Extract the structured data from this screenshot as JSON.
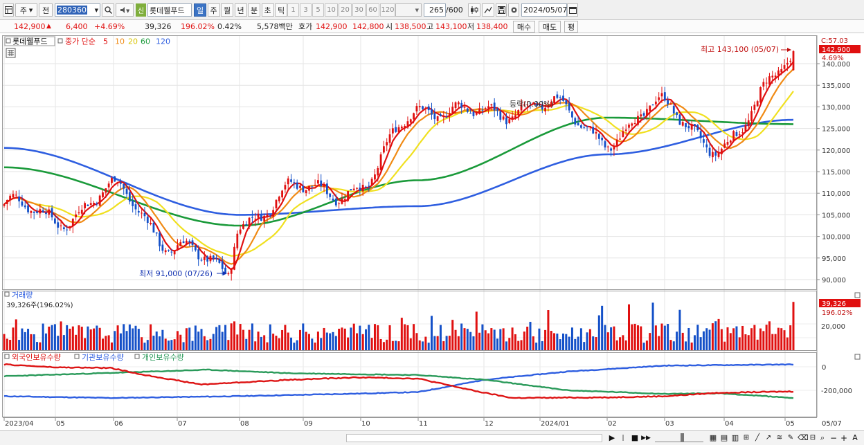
{
  "toolbar": {
    "market": "주",
    "prev_label": "전",
    "code": "280360",
    "stock_name": "롯데웰푸드",
    "periods": [
      "일",
      "주",
      "월",
      "년",
      "분",
      "초",
      "틱"
    ],
    "active_period": "일",
    "numbers": [
      "1",
      "3",
      "5",
      "10",
      "20",
      "30",
      "60",
      "120"
    ],
    "count": "265",
    "total": "/600",
    "date": "2024/05/07",
    "new_badge": "신"
  },
  "quote": {
    "price": "142,900",
    "change": "6,400",
    "change_pct": "+4.69%",
    "volume": "39,326",
    "vol_ratio": "196.02%",
    "turnover": "0.42%",
    "amount": "5,578백만",
    "ask_label": "호가",
    "ask": "142,900",
    "bid": "142,800",
    "open_label": "시",
    "open": "138,500",
    "high_label": "고",
    "high": "143,100",
    "low_label": "저",
    "low": "138,400",
    "buy_label": "매수",
    "sell_label": "매도",
    "eval_label": "평"
  },
  "price_panel": {
    "legend_name": "롯데웰푸드",
    "legend_ma_label": "종가 단순",
    "legend_periods": [
      "5",
      "10",
      "20",
      "60",
      "120"
    ],
    "high_annotation": "최고 143,100 (05/07)",
    "low_annotation": "최저 91,000 (07/26)",
    "mid_annotation": "등락(0.00%)",
    "scale_top": "C:57.03",
    "current_price_tag": "142,900",
    "current_pct": "4.69%",
    "y_ticks": [
      "140,000",
      "135,000",
      "130,000",
      "125,000",
      "120,000",
      "115,000",
      "110,000",
      "105,000",
      "100,000",
      "95,000",
      "90,000"
    ]
  },
  "volume_panel": {
    "title": "거래량",
    "subtitle": "39,326주(196.02%)",
    "tag_value": "39,326",
    "tag_pct": "196.02%",
    "y_ticks": [
      "20,000"
    ]
  },
  "holding_panel": {
    "legend": [
      "외국인보유수량",
      "기관보유수량",
      "개인보유수량"
    ],
    "y_ticks": [
      "0",
      "-200,000"
    ]
  },
  "x_axis": {
    "labels": [
      "2023/04",
      "05",
      "06",
      "07",
      "08",
      "09",
      "10",
      "11",
      "12",
      "2024/01",
      "02",
      "03",
      "04",
      "05"
    ],
    "right_label": "05/07"
  },
  "colors": {
    "up": "#e01010",
    "down": "#1450c8",
    "ma5": "#e01010",
    "ma10": "#f08a14",
    "ma20": "#f0e020",
    "ma60": "#1a9a3a",
    "ma120": "#2e5ee0",
    "foreign": "#dd1414",
    "institution": "#2e5ee0",
    "individual": "#2a9a5a"
  },
  "chart_data": {
    "type": "candlestick",
    "x_months": [
      "2023/04",
      "05",
      "06",
      "07",
      "08",
      "09",
      "10",
      "11",
      "12",
      "2024/01",
      "02",
      "03",
      "04",
      "05"
    ],
    "price_path": [
      {
        "date": "2023/04",
        "close": 107500
      },
      {
        "date": "05",
        "close": 104000
      },
      {
        "date": "06",
        "close": 110500
      },
      {
        "date": "07",
        "close": 98000
      },
      {
        "date": "07/26",
        "close": 91000
      },
      {
        "date": "08",
        "close": 104000
      },
      {
        "date": "09",
        "close": 111000
      },
      {
        "date": "10",
        "close": 111000
      },
      {
        "date": "11",
        "close": 130000
      },
      {
        "date": "12",
        "close": 128000
      },
      {
        "date": "2024/01",
        "close": 131000
      },
      {
        "date": "02",
        "close": 123000
      },
      {
        "date": "03",
        "close": 130000
      },
      {
        "date": "04",
        "close": 120000
      },
      {
        "date": "05/07",
        "close": 142900
      }
    ],
    "ma60_path": [
      {
        "date": "2023/04",
        "value": 116000
      },
      {
        "date": "08",
        "value": 102500
      },
      {
        "date": "11",
        "value": 113000
      },
      {
        "date": "02",
        "value": 127500
      },
      {
        "date": "05/07",
        "value": 126000
      }
    ],
    "ma120_path": [
      {
        "date": "2023/04",
        "value": 120500
      },
      {
        "date": "08",
        "value": 105000
      },
      {
        "date": "11",
        "value": 107000
      },
      {
        "date": "02",
        "value": 119000
      },
      {
        "date": "05/07",
        "value": 127000
      }
    ],
    "ylim": [
      88000,
      145000
    ],
    "legend": [
      "5",
      "10",
      "20",
      "60",
      "120"
    ],
    "volume_last": 39326,
    "holding_series": [
      "외국인보유수량",
      "기관보유수량",
      "개인보유수량"
    ],
    "holding_ylim": [
      -300000,
      80000
    ]
  }
}
